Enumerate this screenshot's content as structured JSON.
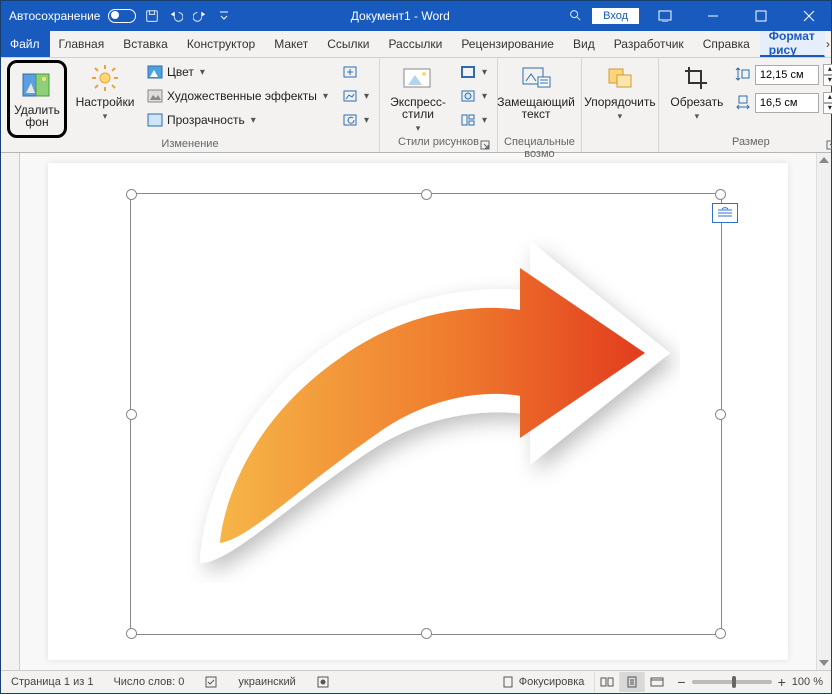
{
  "titlebar": {
    "autosave": "Автосохранение",
    "doc_title": "Документ1 - Word",
    "search_icon": "🔍",
    "login": "Вход"
  },
  "tabs": {
    "file": "Файл",
    "items": [
      "Главная",
      "Вставка",
      "Конструктор",
      "Макет",
      "Ссылки",
      "Рассылки",
      "Рецензирование",
      "Вид",
      "Разработчик",
      "Справка"
    ],
    "active": "Формат рису"
  },
  "ribbon": {
    "remove_bg": "Удалить фон",
    "corrections": "Настройки",
    "color": "Цвет",
    "art_effects": "Художественные эффекты",
    "transparency": "Прозрачность",
    "group_change": "Изменение",
    "express_styles": "Экспресс-стили",
    "group_styles": "Стили рисунков",
    "alt_text": "Замещающий текст",
    "group_access": "Специальные возмо",
    "arrange": "Упорядочить",
    "crop": "Обрезать",
    "width_value": "12,15 см",
    "height_value": "16,5 см",
    "group_size": "Размер"
  },
  "status": {
    "page": "Страница 1 из 1",
    "words": "Число слов: 0",
    "lang": "украинский",
    "focus": "Фокусировка",
    "zoom": "100 %"
  }
}
